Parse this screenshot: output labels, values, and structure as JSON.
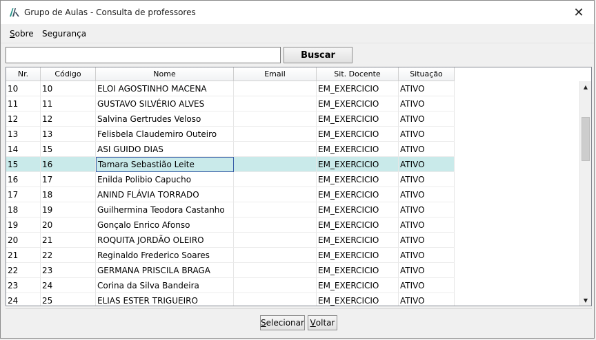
{
  "window": {
    "title": "Grupo de Aulas - Consulta de professores",
    "close_glyph": "✕"
  },
  "menu": {
    "items": [
      {
        "accel": "S",
        "rest": "obre"
      },
      {
        "accel": "",
        "rest": "Segurança"
      }
    ]
  },
  "search": {
    "value": "",
    "placeholder": "",
    "button_label": "Buscar"
  },
  "table": {
    "columns": [
      "Nr.",
      "Código",
      "Nome",
      "Email",
      "Sit. Docente",
      "Situação"
    ],
    "rows": [
      {
        "nr": "10",
        "codigo": "10",
        "nome": "ELOI AGOSTINHO MACENA",
        "email": "",
        "sit_docente": "EM_EXERCICIO",
        "situacao": "ATIVO"
      },
      {
        "nr": "11",
        "codigo": "11",
        "nome": "GUSTAVO SILVÉRIO ALVES",
        "email": "",
        "sit_docente": "EM_EXERCICIO",
        "situacao": "ATIVO"
      },
      {
        "nr": "12",
        "codigo": "12",
        "nome": "Salvina Gertrudes Veloso",
        "email": "",
        "sit_docente": "EM_EXERCICIO",
        "situacao": "ATIVO"
      },
      {
        "nr": "13",
        "codigo": "13",
        "nome": "Felisbela Claudemiro Outeiro",
        "email": "",
        "sit_docente": "EM_EXERCICIO",
        "situacao": "ATIVO"
      },
      {
        "nr": "14",
        "codigo": "15",
        "nome": "ASI GUIDO DIAS",
        "email": "",
        "sit_docente": "EM_EXERCICIO",
        "situacao": "ATIVO"
      },
      {
        "nr": "15",
        "codigo": "16",
        "nome": "Tamara Sebastião Leite",
        "email": "",
        "sit_docente": "EM_EXERCICIO",
        "situacao": "ATIVO"
      },
      {
        "nr": "16",
        "codigo": "17",
        "nome": "Enilda Polibio Capucho",
        "email": "",
        "sit_docente": "EM_EXERCICIO",
        "situacao": "ATIVO"
      },
      {
        "nr": "17",
        "codigo": "18",
        "nome": "ANIND FLÁVIA TORRADO",
        "email": "",
        "sit_docente": "EM_EXERCICIO",
        "situacao": "ATIVO"
      },
      {
        "nr": "18",
        "codigo": "19",
        "nome": "Guilhermina Teodora Castanho",
        "email": "",
        "sit_docente": "EM_EXERCICIO",
        "situacao": "ATIVO"
      },
      {
        "nr": "19",
        "codigo": "20",
        "nome": "Gonçalo Enrico Afonso",
        "email": "",
        "sit_docente": "EM_EXERCICIO",
        "situacao": "ATIVO"
      },
      {
        "nr": "20",
        "codigo": "21",
        "nome": "ROQUITA JORDÃO OLEIRO",
        "email": "",
        "sit_docente": "EM_EXERCICIO",
        "situacao": "ATIVO"
      },
      {
        "nr": "21",
        "codigo": "22",
        "nome": "Reginaldo Frederico Soares",
        "email": "",
        "sit_docente": "EM_EXERCICIO",
        "situacao": "ATIVO"
      },
      {
        "nr": "22",
        "codigo": "23",
        "nome": "GERMANA PRISCILA BRAGA",
        "email": "",
        "sit_docente": "EM_EXERCICIO",
        "situacao": "ATIVO"
      },
      {
        "nr": "23",
        "codigo": "24",
        "nome": "Corina da Silva Bandeira",
        "email": "",
        "sit_docente": "EM_EXERCICIO",
        "situacao": "ATIVO"
      },
      {
        "nr": "24",
        "codigo": "25",
        "nome": "ELIAS ESTER TRIGUEIRO",
        "email": "",
        "sit_docente": "EM_EXERCICIO",
        "situacao": "ATIVO"
      }
    ],
    "selected_row_index": 5
  },
  "icons": {
    "app": "app-logo-icon",
    "scroll_up": "▲",
    "scroll_down": "▼"
  },
  "footer": {
    "select_button": {
      "accel": "S",
      "rest": "elecionar"
    },
    "back_button": {
      "accel": "V",
      "rest": "oltar"
    }
  },
  "colors": {
    "selected_row": "#c9eaea",
    "focus_border": "#3a5fa8"
  }
}
